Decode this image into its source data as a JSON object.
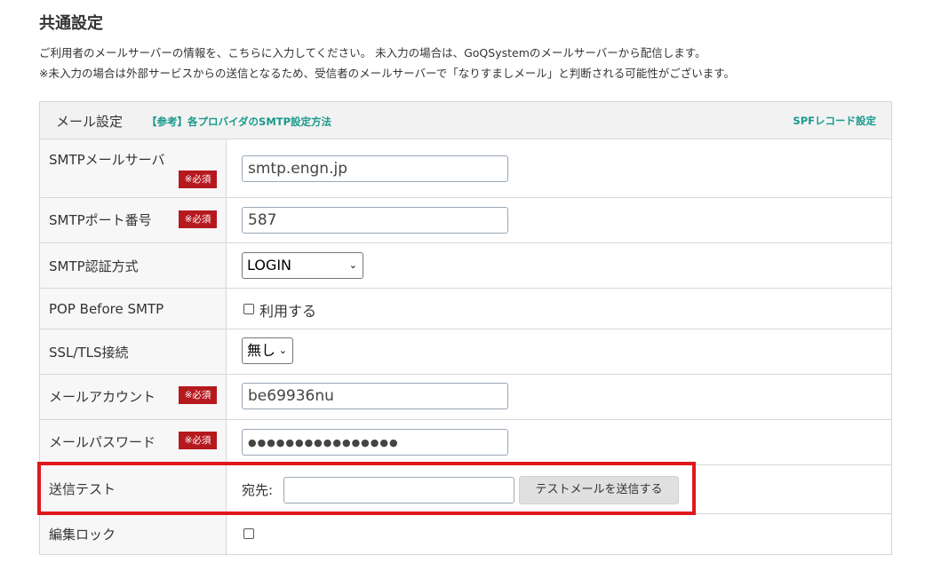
{
  "page": {
    "title": "共通設定",
    "desc1": "ご利用者のメールサーバーの情報を、こちらに入力してください。 未入力の場合は、GoQSystemのメールサーバーから配信します。",
    "desc2": "※未入力の場合は外部サービスからの送信となるため、受信者のメールサーバーで「なりすましメール」と判断される可能性がございます。"
  },
  "table": {
    "header_title": "メール設定",
    "header_ref_link": "【参考】各プロバイダのSMTP設定方法",
    "header_spf_link": "SPFレコード設定",
    "required_badge": "※必須"
  },
  "rows": {
    "smtp_server": {
      "label": "SMTPメールサーバ",
      "value": "smtp.engn.jp"
    },
    "smtp_port": {
      "label": "SMTPポート番号",
      "value": "587"
    },
    "smtp_auth": {
      "label": "SMTP認証方式",
      "selected": "LOGIN"
    },
    "pop_before": {
      "label": "POP Before SMTP",
      "checkbox_label": "利用する",
      "checked": false
    },
    "ssl_tls": {
      "label": "SSL/TLS接続",
      "selected": "無し"
    },
    "mail_account": {
      "label": "メールアカウント",
      "value": "be69936nu"
    },
    "mail_password": {
      "label": "メールパスワード",
      "value": "●●●●●●●●●●●●●●●●"
    },
    "send_test": {
      "label": "送信テスト",
      "to_label": "宛先:",
      "to_value": "",
      "button_label": "テストメールを送信する"
    },
    "edit_lock": {
      "label": "編集ロック",
      "checked": false
    }
  },
  "colors": {
    "required_badge": "#b5191e",
    "link": "#1a9a8c",
    "highlight": "#e0171d"
  }
}
